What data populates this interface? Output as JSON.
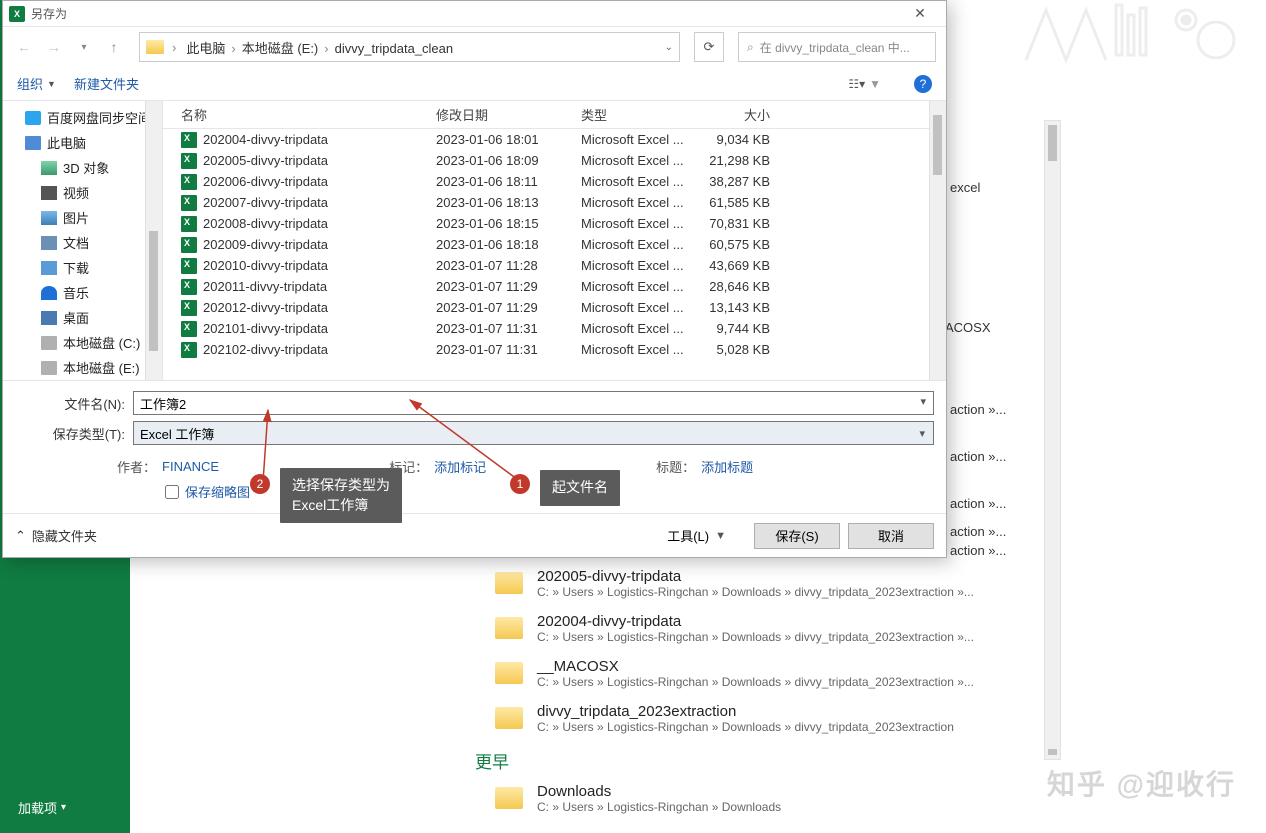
{
  "excel_sidebar": {
    "addin": "加载项"
  },
  "dialog": {
    "title": "另存为",
    "breadcrumb": [
      "此电脑",
      "本地磁盘 (E:)",
      "divvy_tripdata_clean"
    ],
    "search_placeholder": "在 divvy_tripdata_clean 中...",
    "toolbar": {
      "organize": "组织",
      "new_folder": "新建文件夹"
    },
    "columns": {
      "name": "名称",
      "date": "修改日期",
      "type": "类型",
      "size": "大小"
    },
    "tree": [
      {
        "icon": "baidu",
        "label": "百度网盘同步空间",
        "indent": false
      },
      {
        "icon": "pc",
        "label": "此电脑",
        "indent": false
      },
      {
        "icon": "3d",
        "label": "3D 对象",
        "indent": true
      },
      {
        "icon": "video",
        "label": "视频",
        "indent": true
      },
      {
        "icon": "pic",
        "label": "图片",
        "indent": true
      },
      {
        "icon": "doc",
        "label": "文档",
        "indent": true
      },
      {
        "icon": "dl",
        "label": "下载",
        "indent": true
      },
      {
        "icon": "music",
        "label": "音乐",
        "indent": true
      },
      {
        "icon": "desktop",
        "label": "桌面",
        "indent": true
      },
      {
        "icon": "drive",
        "label": "本地磁盘 (C:)",
        "indent": true
      },
      {
        "icon": "drive",
        "label": "本地磁盘 (E:)",
        "indent": true
      }
    ],
    "files": [
      {
        "name": "202004-divvy-tripdata",
        "date": "2023-01-06 18:01",
        "type": "Microsoft Excel ...",
        "size": "9,034 KB"
      },
      {
        "name": "202005-divvy-tripdata",
        "date": "2023-01-06 18:09",
        "type": "Microsoft Excel ...",
        "size": "21,298 KB"
      },
      {
        "name": "202006-divvy-tripdata",
        "date": "2023-01-06 18:11",
        "type": "Microsoft Excel ...",
        "size": "38,287 KB"
      },
      {
        "name": "202007-divvy-tripdata",
        "date": "2023-01-06 18:13",
        "type": "Microsoft Excel ...",
        "size": "61,585 KB"
      },
      {
        "name": "202008-divvy-tripdata",
        "date": "2023-01-06 18:15",
        "type": "Microsoft Excel ...",
        "size": "70,831 KB"
      },
      {
        "name": "202009-divvy-tripdata",
        "date": "2023-01-06 18:18",
        "type": "Microsoft Excel ...",
        "size": "60,575 KB"
      },
      {
        "name": "202010-divvy-tripdata",
        "date": "2023-01-07 11:28",
        "type": "Microsoft Excel ...",
        "size": "43,669 KB"
      },
      {
        "name": "202011-divvy-tripdata",
        "date": "2023-01-07 11:29",
        "type": "Microsoft Excel ...",
        "size": "28,646 KB"
      },
      {
        "name": "202012-divvy-tripdata",
        "date": "2023-01-07 11:29",
        "type": "Microsoft Excel ...",
        "size": "13,143 KB"
      },
      {
        "name": "202101-divvy-tripdata",
        "date": "2023-01-07 11:31",
        "type": "Microsoft Excel ...",
        "size": "9,744 KB"
      },
      {
        "name": "202102-divvy-tripdata",
        "date": "2023-01-07 11:31",
        "type": "Microsoft Excel ...",
        "size": "5,028 KB"
      }
    ],
    "filename_label": "文件名(N):",
    "filename_value": "工作簿2",
    "filetype_label": "保存类型(T):",
    "filetype_value": "Excel 工作簿",
    "author_label": "作者：",
    "author_value": "FINANCE",
    "tag_label": "标记：",
    "tag_value": "添加标记",
    "title_meta_label": "标题：",
    "title_meta_value": "添加标题",
    "thumbnail_label": "保存缩略图",
    "hide_folders": "隐藏文件夹",
    "tools": "工具(L)",
    "save": "保存(S)",
    "cancel": "取消"
  },
  "annotations": {
    "callout1": "起文件名",
    "callout2_l1": "选择保存类型为",
    "callout2_l2": "Excel工作簿",
    "num1": "1",
    "num2": "2"
  },
  "background": {
    "peek_excel_row": "excel",
    "peek_macosx_row": "ACOSX",
    "peek_action1": "action »...",
    "peek_action2": "action »...",
    "peek_action3": "action »...",
    "peek_action4": "action »...",
    "peek_action5": "action »...",
    "folders": [
      {
        "title": "202005-divvy-tripdata",
        "path": "C: » Users » Logistics-Ringchan » Downloads » divvy_tripdata_2023extraction »..."
      },
      {
        "title": "202004-divvy-tripdata",
        "path": "C: » Users » Logistics-Ringchan » Downloads » divvy_tripdata_2023extraction »..."
      },
      {
        "title": "__MACOSX",
        "path": "C: » Users » Logistics-Ringchan » Downloads » divvy_tripdata_2023extraction »..."
      },
      {
        "title": "divvy_tripdata_2023extraction",
        "path": "C: » Users » Logistics-Ringchan » Downloads » divvy_tripdata_2023extraction"
      }
    ],
    "section": "更早",
    "earlier": [
      {
        "title": "Downloads",
        "path": "C: » Users » Logistics-Ringchan » Downloads"
      }
    ]
  },
  "watermark": "知乎 @迎收行"
}
